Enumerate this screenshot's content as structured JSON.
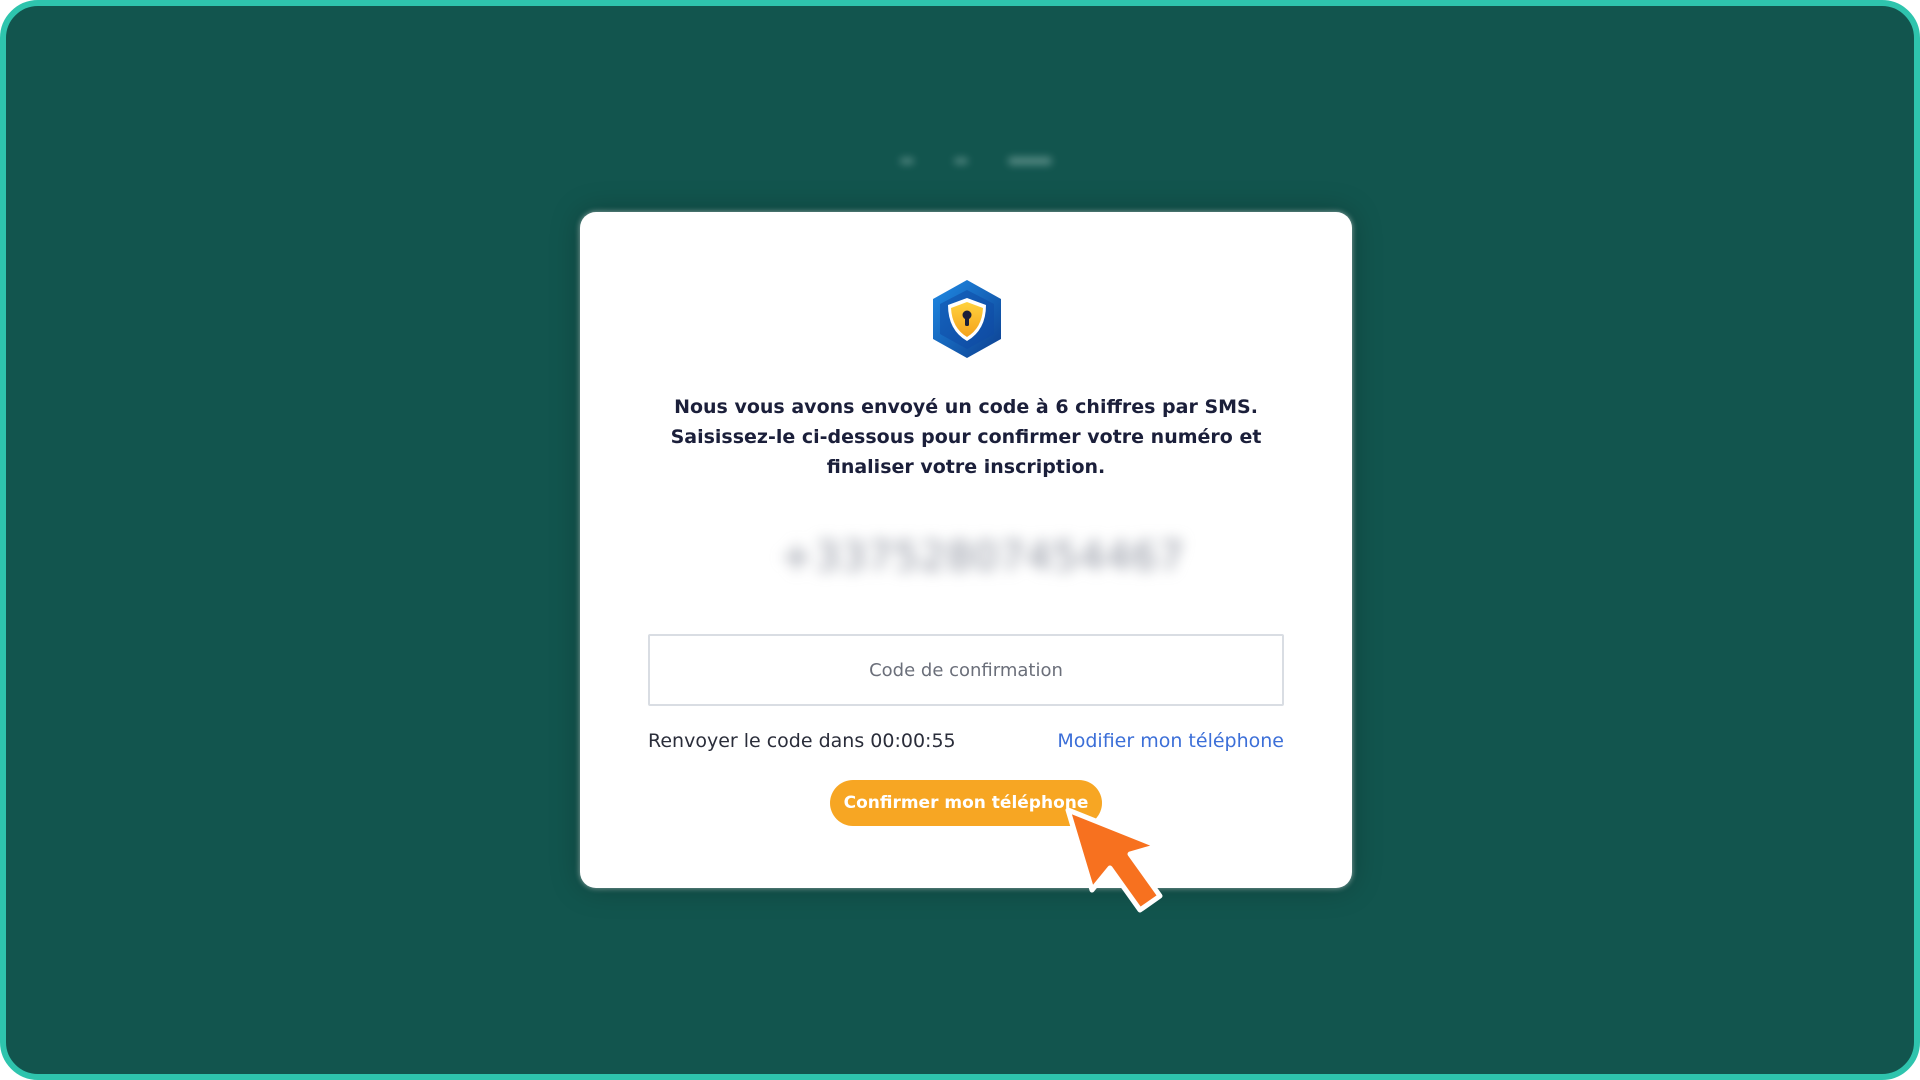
{
  "verification": {
    "message_line1": "Nous vous avons envoyé un code à 6 chiffres par SMS.",
    "message_line2": "Saisissez-le ci-dessous pour confirmer votre numéro et",
    "message_line3": "finaliser votre inscription.",
    "phone_number": "+33752807454467",
    "code_placeholder": "Code de confirmation",
    "code_value": "",
    "resend_text": "Renvoyer le code dans 00:00:55",
    "modify_link": "Modifier mon téléphone",
    "confirm_button": "Confirmer mon téléphone"
  },
  "icons": {
    "logo": "shield-lock-icon",
    "pointer": "cursor-arrow-icon"
  },
  "colors": {
    "background": "#12554e",
    "frame_border": "#2ec4ad",
    "accent_button": "#f7a623",
    "link": "#3c6fd8",
    "cursor": "#f7711f"
  }
}
